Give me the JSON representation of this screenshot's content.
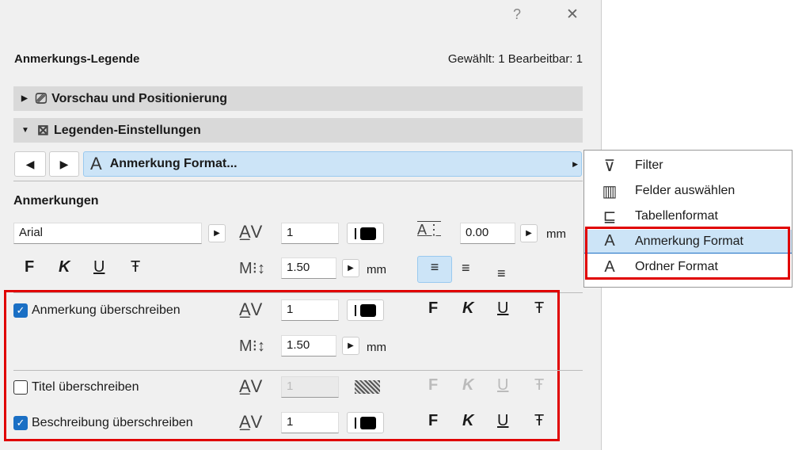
{
  "titlebar": {
    "help": "?",
    "close": "✕"
  },
  "header": {
    "title": "Anmerkungs-Legende",
    "status": "Gewählt: 1 Bearbeitbar: 1"
  },
  "sections": [
    {
      "label": "Vorschau und Positionierung",
      "expanded": false
    },
    {
      "label": "Legenden-Einstellungen",
      "expanded": true
    }
  ],
  "nav": {
    "prev": "◀",
    "next": "▶",
    "current": "Anmerkung Format..."
  },
  "anmerkungen": {
    "heading": "Anmerkungen",
    "font": "Arial",
    "pen": "1",
    "offset": "0.00",
    "offset_unit": "mm",
    "size": "1.50",
    "size_unit": "mm",
    "styles": [
      "F",
      "K",
      "U",
      "Ŧ"
    ]
  },
  "overrides": [
    {
      "label": "Anmerkung überschreiben",
      "checked": true,
      "pen": "1",
      "size": "1.50",
      "unit": "mm"
    },
    {
      "label": "Titel überschreiben",
      "checked": false,
      "pen": "1"
    },
    {
      "label": "Beschreibung überschreiben",
      "checked": true,
      "pen": "1"
    }
  ],
  "menu": {
    "items": [
      {
        "label": "Filter",
        "icon": "filter-icon",
        "glyph": "⊽"
      },
      {
        "label": "Felder auswählen",
        "icon": "columns-icon",
        "glyph": "▥"
      },
      {
        "label": "Tabellenformat",
        "icon": "table-format-icon",
        "glyph": "⊑"
      },
      {
        "label": "Anmerkung Format",
        "icon": "text-format-icon",
        "glyph": "A",
        "selected": true
      },
      {
        "label": "Ordner Format",
        "icon": "text-format-icon",
        "glyph": "A"
      }
    ]
  },
  "colors": {
    "highlight": "#cce4f7",
    "red": "#e00000",
    "check": "#1a6fc4"
  }
}
